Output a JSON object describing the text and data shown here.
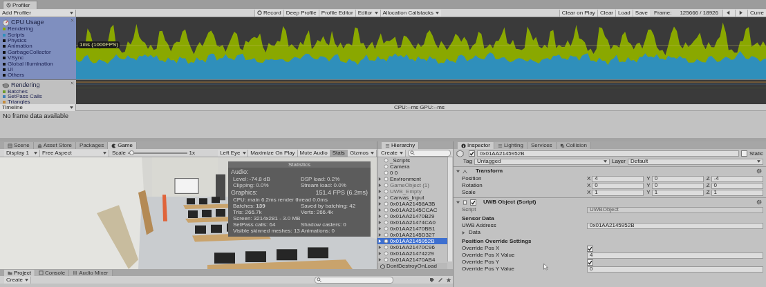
{
  "profiler": {
    "tab": "Profiler",
    "add_profiler": "Add Profiler",
    "toolbar_left": [
      {
        "kind": "record",
        "label": "Record"
      },
      {
        "kind": "button",
        "label": "Deep Profile"
      },
      {
        "kind": "button",
        "label": "Profile Editor"
      },
      {
        "kind": "dropdown",
        "label": "Editor"
      },
      {
        "kind": "dropdown",
        "label": "Allocation Callstacks"
      }
    ],
    "toolbar_right": [
      {
        "kind": "button",
        "label": "Clear on Play"
      },
      {
        "kind": "button",
        "label": "Clear"
      },
      {
        "kind": "button",
        "label": "Load"
      },
      {
        "kind": "button",
        "label": "Save"
      },
      {
        "kind": "label",
        "label": "Frame:"
      },
      {
        "kind": "label",
        "label": "125666 / 18926"
      },
      {
        "kind": "prev"
      },
      {
        "kind": "next"
      },
      {
        "kind": "button",
        "label": "Curre"
      }
    ],
    "modules": [
      {
        "kind": "cpu",
        "title": "CPU Usage",
        "selected": true,
        "legend": [
          {
            "label": "Rendering",
            "color": "#8aa800"
          },
          {
            "label": "Scripts",
            "color": "#2f8fbb"
          },
          {
            "label": "Physics",
            "color": "#111111"
          },
          {
            "label": "Animation",
            "color": "#111111"
          },
          {
            "label": "GarbageCollector",
            "color": "#111111"
          },
          {
            "label": "VSync",
            "color": "#111111"
          },
          {
            "label": "Global Illumination",
            "color": "#111111"
          },
          {
            "label": "UI",
            "color": "#111111"
          },
          {
            "label": "Others",
            "color": "#111111"
          }
        ]
      },
      {
        "kind": "rendering",
        "title": "Rendering",
        "selected": false,
        "legend": [
          {
            "label": "Batches",
            "color": "#6e9a2a"
          },
          {
            "label": "SetPass Calls",
            "color": "#3f7fb5"
          },
          {
            "label": "Triangles",
            "color": "#c58a3a"
          }
        ]
      }
    ],
    "chart_label": "1ms (1000FPS)",
    "view_mode": "Timeline",
    "status": "CPU:--ms  GPU:--ms",
    "message": "No frame data available"
  },
  "game": {
    "tabs": [
      {
        "kind": "scene",
        "label": "Scene",
        "selected": false
      },
      {
        "kind": "store",
        "label": "Asset Store",
        "selected": false
      },
      {
        "kind": "packages",
        "label": "Packages",
        "selected": false
      },
      {
        "kind": "game",
        "label": "Game",
        "selected": true
      }
    ],
    "toolbar": [
      {
        "kind": "dropdown",
        "label": "Display 1"
      },
      {
        "kind": "dropdown",
        "label": "Free Aspect"
      },
      {
        "kind": "slider",
        "label": "Scale",
        "value": "1x",
        "level": 0.02
      },
      {
        "kind": "dropdown",
        "label": "Left Eye"
      },
      {
        "kind": "toggle",
        "label": "Maximize On Play",
        "on": false
      },
      {
        "kind": "toggle",
        "label": "Mute Audio",
        "on": false
      },
      {
        "kind": "toggle",
        "label": "Stats",
        "on": true
      },
      {
        "kind": "dropdown",
        "label": "Gizmos"
      }
    ],
    "statistics": {
      "title": "Statistics",
      "sections": [
        {
          "heading": "Audio:",
          "rows": [
            [
              "Level: -74.8 dB",
              "DSP load: 0.2%"
            ],
            [
              "Clipping: 0.0%",
              "Stream load: 0.0%"
            ]
          ]
        },
        {
          "heading": "Graphics:",
          "heading_value": "151.4 FPS (6.2ms)",
          "rows": [
            [
              "CPU: main 6.2ms  render thread 0.0ms"
            ],
            [
              "Batches: **139**",
              "Saved by batching: 42"
            ],
            [
              "Tris: 266.7k",
              "Verts: 266.4k"
            ],
            [
              "Screen: 3214x281 - 3.0 MB"
            ],
            [
              "SetPass calls: 64",
              "Shadow casters: 0"
            ],
            [
              "Visible skinned meshes: 13  Animations: 0"
            ]
          ]
        }
      ]
    }
  },
  "hierarchy": {
    "tab": "Hierarchy",
    "create": "Create",
    "items": [
      {
        "label": "_Scripts",
        "expandable": false,
        "disabled": false,
        "selected": false
      },
      {
        "label": "Camera",
        "expandable": false,
        "disabled": false,
        "selected": false
      },
      {
        "label": "0 0",
        "expandable": false,
        "disabled": false,
        "selected": false
      },
      {
        "label": "Environment",
        "expandable": true,
        "disabled": false,
        "selected": false
      },
      {
        "label": "GameObject (1)",
        "expandable": true,
        "disabled": true,
        "selected": false
      },
      {
        "label": "UWB_Empty",
        "expandable": true,
        "disabled": true,
        "selected": false
      },
      {
        "label": "Canvas_Input",
        "expandable": true,
        "disabled": false,
        "selected": false
      },
      {
        "label": "0x01AA21458A3B",
        "expandable": true,
        "disabled": false,
        "selected": false
      },
      {
        "label": "0x01AA2145CCAC",
        "expandable": true,
        "disabled": false,
        "selected": false
      },
      {
        "label": "0x01AA21470B29",
        "expandable": true,
        "disabled": false,
        "selected": false
      },
      {
        "label": "0x01AA21474CA0",
        "expandable": true,
        "disabled": false,
        "selected": false
      },
      {
        "label": "0x01AA21470BB1",
        "expandable": true,
        "disabled": false,
        "selected": false
      },
      {
        "label": "0x01AA2145D327",
        "expandable": true,
        "disabled": false,
        "selected": false
      },
      {
        "label": "0x01AA2145952B",
        "expandable": true,
        "disabled": false,
        "selected": true
      },
      {
        "label": "0x01AA21470C96",
        "expandable": true,
        "disabled": false,
        "selected": false
      },
      {
        "label": "0x01AA21474229",
        "expandable": true,
        "disabled": false,
        "selected": false
      },
      {
        "label": "0x01AA21470AB4",
        "expandable": true,
        "disabled": false,
        "selected": false
      }
    ],
    "scene": "DontDestroyOnLoad"
  },
  "inspector": {
    "tabs": [
      {
        "kind": "inspector",
        "label": "Inspector",
        "selected": true
      },
      {
        "kind": "lighting",
        "label": "Lighting",
        "selected": false
      },
      {
        "kind": "services",
        "label": "Services",
        "selected": false
      },
      {
        "kind": "collision",
        "label": "Collision",
        "selected": false
      }
    ],
    "object": {
      "active": true,
      "name": "0x01AA2145952B",
      "static_label": "Static",
      "static": false,
      "tag_label": "Tag",
      "tag": "Untagged",
      "layer_label": "Layer",
      "layer": "Default"
    },
    "components": [
      {
        "kind": "transform",
        "title": "Transform",
        "expanded": true,
        "rows": [
          {
            "label": "Position",
            "values": [
              {
                "axis": "X",
                "value": "4"
              },
              {
                "axis": "Y",
                "value": "0"
              },
              {
                "axis": "Z",
                "value": "-4"
              }
            ]
          },
          {
            "label": "Rotation",
            "values": [
              {
                "axis": "X",
                "value": "0"
              },
              {
                "axis": "Y",
                "value": "0"
              },
              {
                "axis": "Z",
                "value": "0"
              }
            ]
          },
          {
            "label": "Scale",
            "values": [
              {
                "axis": "X",
                "value": "1"
              },
              {
                "axis": "Y",
                "value": "1"
              },
              {
                "axis": "Z",
                "value": "1"
              }
            ]
          }
        ]
      },
      {
        "kind": "script",
        "title": "UWB Object (Script)",
        "expanded": true,
        "enabled": true,
        "fields": [
          {
            "kind": "object",
            "label": "Script",
            "value": "UWBObject",
            "disabled": true
          },
          {
            "kind": "header",
            "label": "Sensor Data"
          },
          {
            "kind": "text",
            "label": "UWB Address",
            "value": "0x01AA2145952B"
          },
          {
            "kind": "foldout",
            "label": "Data",
            "expanded": false
          },
          {
            "kind": "header",
            "label": "Position Override Settings"
          },
          {
            "kind": "toggle",
            "label": "Override Pos X",
            "checked": true
          },
          {
            "kind": "text",
            "label": "Override Pos X Value",
            "value": "4"
          },
          {
            "kind": "toggle",
            "label": "Override Pos Y",
            "checked": true
          },
          {
            "kind": "text",
            "label": "Override Pos Y Value",
            "value": "0"
          }
        ]
      }
    ]
  },
  "project": {
    "tabs": [
      {
        "kind": "project",
        "label": "Project",
        "selected": true
      },
      {
        "kind": "console",
        "label": "Console",
        "selected": false
      },
      {
        "kind": "mixer",
        "label": "Audio Mixer",
        "selected": false
      }
    ],
    "create": "Create"
  }
}
